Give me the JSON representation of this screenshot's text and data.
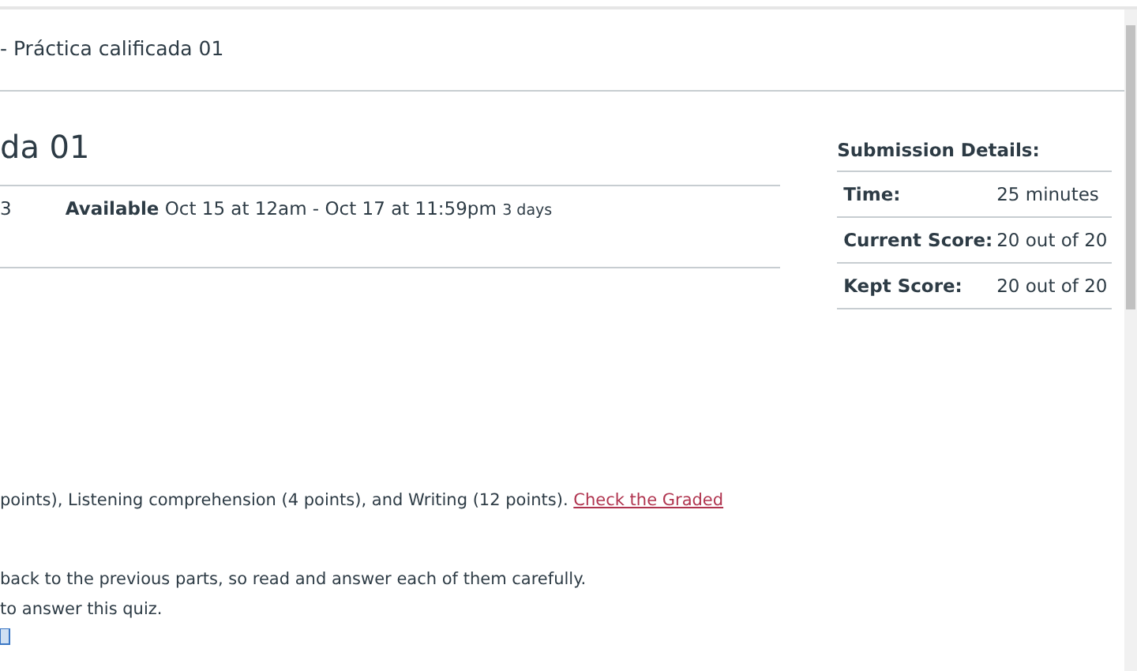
{
  "breadcrumb": "- Práctica calificada 01",
  "title": "da 01",
  "details": {
    "column_1": "3",
    "available_label": "Available",
    "available_value": "Oct 15 at 12am - Oct 17 at 11:59pm",
    "duration": "3 days"
  },
  "submission": {
    "heading": "Submission Details:",
    "rows": [
      {
        "label": "Time:",
        "value": "25 minutes"
      },
      {
        "label": "Current Score:",
        "value": "20 out of 20"
      },
      {
        "label": "Kept Score:",
        "value": "20 out of 20"
      }
    ]
  },
  "instructions": {
    "line_1": "points), Listening comprehension (4 points), and Writing (12 points).",
    "link": "Check the Graded",
    "line_2": "back to the previous parts, so read and answer each of them carefully.",
    "line_3": "to answer this quiz."
  }
}
